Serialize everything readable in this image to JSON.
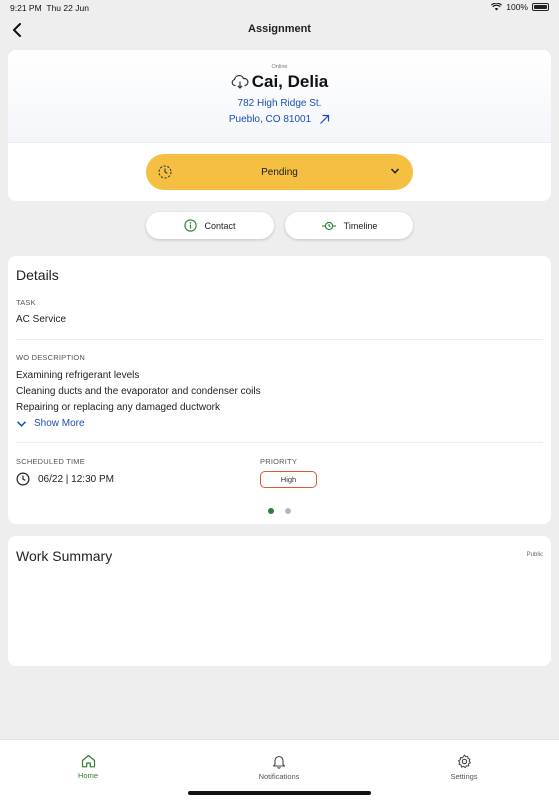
{
  "status_bar": {
    "time": "9:21 PM",
    "date": "Thu 22 Jun",
    "battery": "100%"
  },
  "nav": {
    "title": "Assignment"
  },
  "customer": {
    "presence": "Online",
    "name": "Cai, Delia",
    "address_line1": "782 High Ridge St.",
    "address_line2": "Pueblo, CO 81001"
  },
  "status": {
    "label": "Pending",
    "color": "#f5bf41"
  },
  "actions": {
    "contact": "Contact",
    "timeline": "Timeline"
  },
  "details": {
    "title": "Details",
    "task_label": "TASK",
    "task_value": "AC Service",
    "wo_label": "WO DESCRIPTION",
    "wo_lines": [
      "Examining refrigerant levels",
      "Cleaning ducts and the evaporator and condenser coils",
      "Repairing or replacing any damaged ductwork"
    ],
    "show_more": "Show More",
    "scheduled_label": "SCHEDULED TIME",
    "scheduled_value": "06/22 | 12:30 PM",
    "priority_label": "PRIORITY",
    "priority_value": "High",
    "pages": {
      "count": 2,
      "active": 1
    }
  },
  "work_summary": {
    "title": "Work Summary",
    "visibility": "Public"
  },
  "tabs": {
    "home": "Home",
    "notifications": "Notifications",
    "settings": "Settings"
  },
  "colors": {
    "accent_green": "#2e7d32",
    "link_blue": "#1a4fb5",
    "priority_border": "#d9573a",
    "pending": "#f5bf41"
  }
}
